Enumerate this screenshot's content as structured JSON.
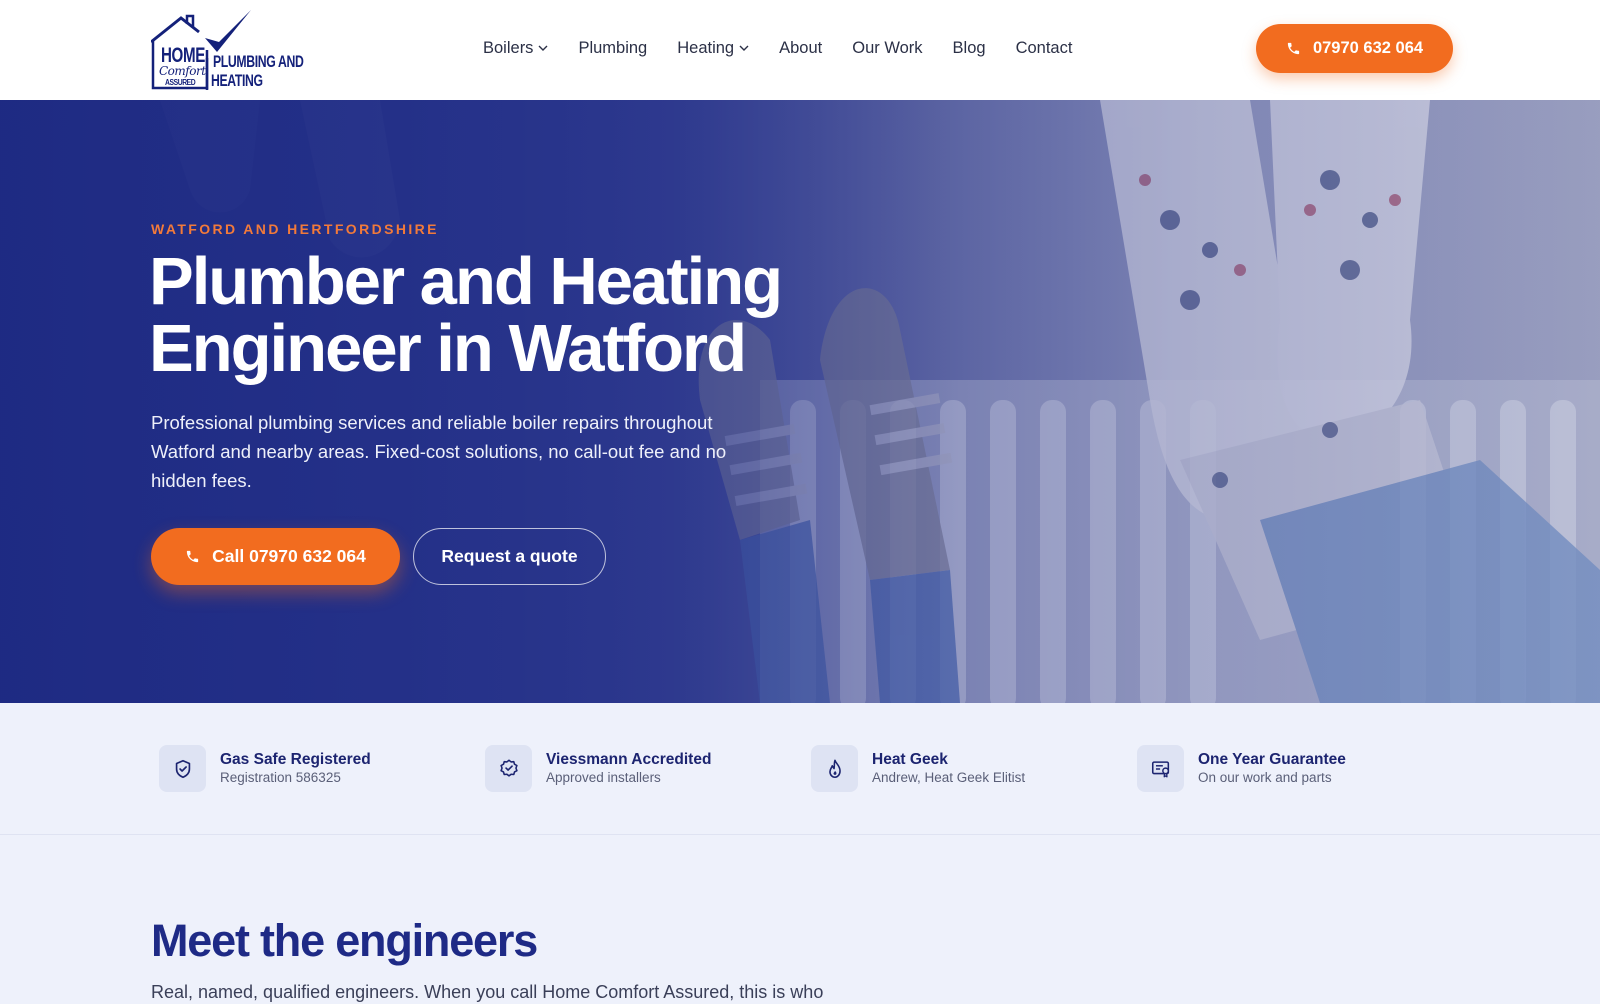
{
  "brand": {
    "logo_home": "HOME",
    "logo_comfort": "Comfort",
    "logo_assured": "ASSURED",
    "logo_line1": "PLUMBING AND",
    "logo_line2": "HEATING"
  },
  "nav": {
    "items": [
      {
        "label": "Boilers",
        "dropdown": true
      },
      {
        "label": "Plumbing",
        "dropdown": false
      },
      {
        "label": "Heating",
        "dropdown": true
      },
      {
        "label": "About",
        "dropdown": false
      },
      {
        "label": "Our Work",
        "dropdown": false
      },
      {
        "label": "Blog",
        "dropdown": false
      },
      {
        "label": "Contact",
        "dropdown": false
      }
    ],
    "phone_label": "07970 632 064",
    "phone_icon": "phone-icon"
  },
  "hero": {
    "eyebrow": "WATFORD AND HERTFORDSHIRE",
    "title_line1": "Plumber and Heating",
    "title_line2": "Engineer in Watford",
    "subtitle": "Professional plumbing services and reliable boiler repairs throughout Watford and nearby areas. Fixed-cost solutions, no call-out fee and no hidden fees.",
    "call_button": "Call 07970 632 064",
    "quote_button": "Request a quote"
  },
  "trust": [
    {
      "title": "Gas Safe Registered",
      "subtitle": "Registration 586325",
      "icon": "shield-check-icon"
    },
    {
      "title": "Viessmann Accredited",
      "subtitle": "Approved installers",
      "icon": "badge-check-icon"
    },
    {
      "title": "Heat Geek",
      "subtitle": "Andrew, Heat Geek Elitist",
      "icon": "flame-icon"
    },
    {
      "title": "One Year Guarantee",
      "subtitle": "On our work and parts",
      "icon": "certificate-icon"
    }
  ],
  "engineers": {
    "title": "Meet the engineers",
    "intro": "Real, named, qualified engineers. When you call Home Comfort Assured, this is who"
  },
  "colors": {
    "accent": "#f26c1f",
    "navy": "#1e2a86",
    "hero_overlay": "#24308a",
    "trust_bg": "#eef1fb"
  }
}
